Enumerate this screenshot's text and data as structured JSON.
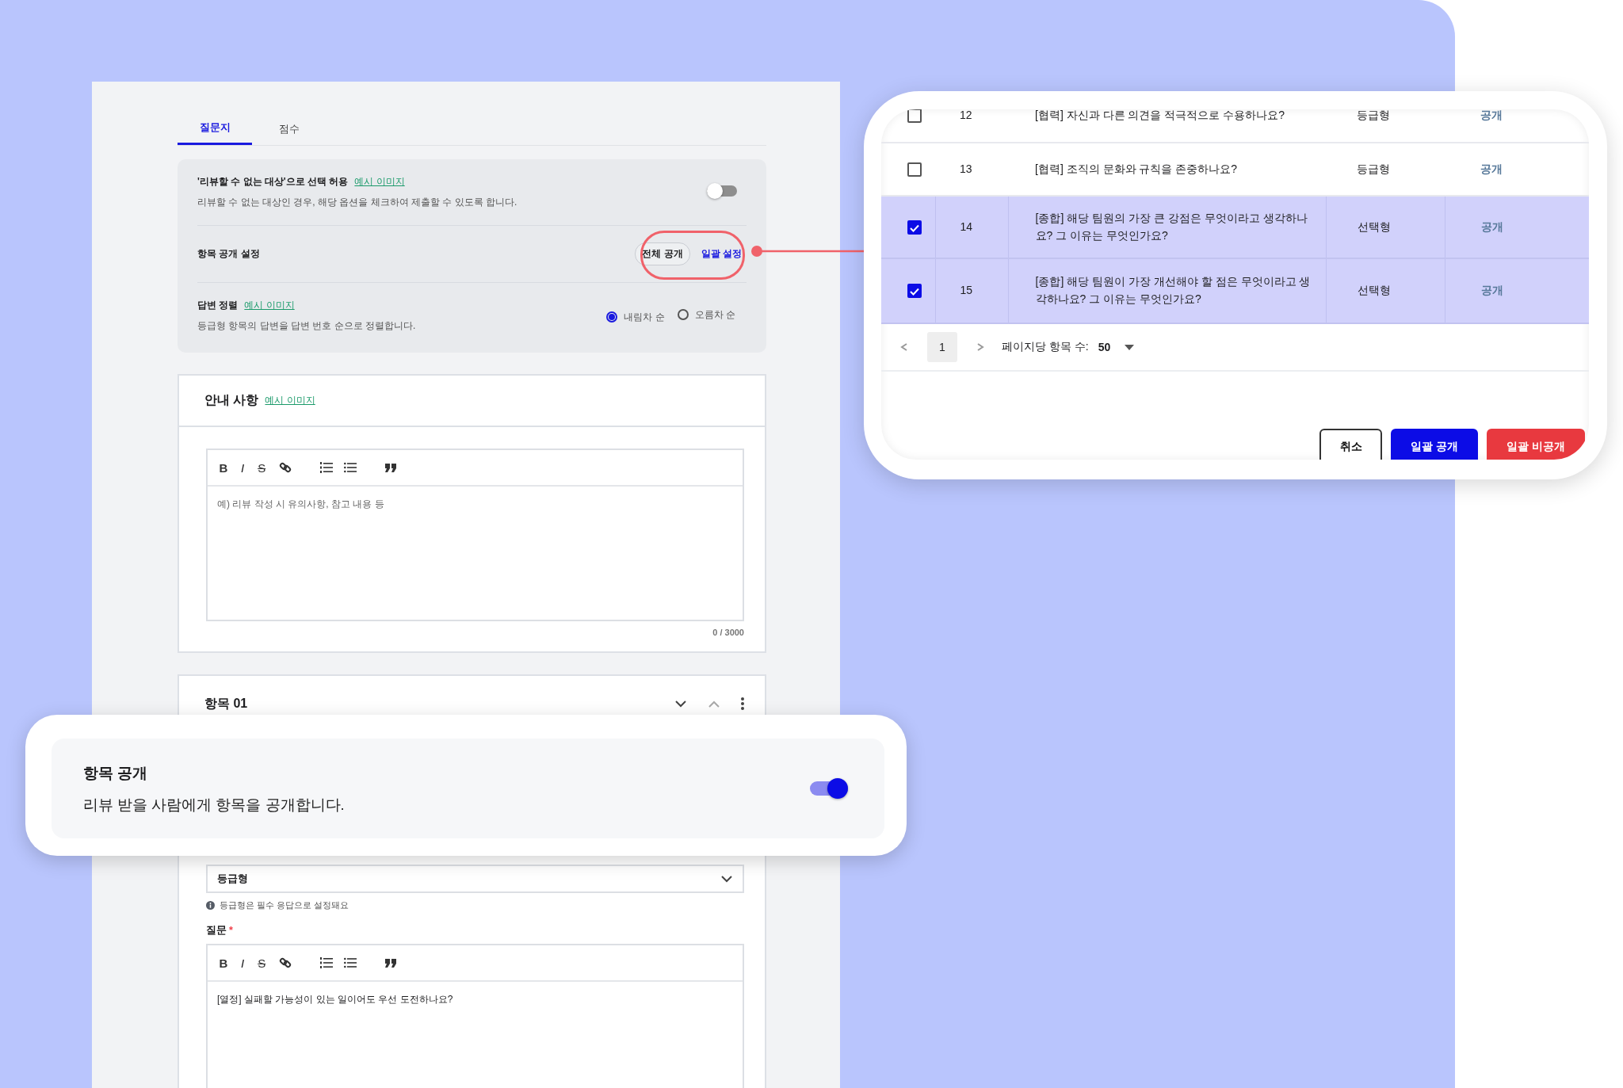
{
  "tabs": [
    {
      "label": "질문지",
      "selected": true
    },
    {
      "label": "점수",
      "selected": false
    }
  ],
  "settings": {
    "allow_unreviewable": {
      "title": "'리뷰할 수 없는 대상'으로 선택 허용",
      "link": "예시 이미지",
      "description": "리뷰할 수 없는 대상인 경우, 해당 옵션을 체크하여 제출할 수 있도록 합니다.",
      "on": false
    },
    "visibility": {
      "title": "항목 공개 설정",
      "pill": "전체 공개",
      "link": "일괄 설정"
    },
    "sort": {
      "title": "답변 정렬",
      "link": "예시 이미지",
      "description": "등급형 항목의 답변을 답변 번호 순으로 정렬합니다.",
      "options": [
        {
          "label": "내림차 순",
          "selected": true
        },
        {
          "label": "오름차 순",
          "selected": false
        }
      ]
    }
  },
  "notice": {
    "title": "안내 사항",
    "link": "예시 이미지",
    "toolbar": [
      {
        "kind": "bold",
        "label": "B"
      },
      {
        "kind": "italic",
        "label": "I"
      },
      {
        "kind": "strike",
        "label": "S"
      },
      {
        "kind": "link"
      },
      {
        "kind": "ordered-list"
      },
      {
        "kind": "bullet-list"
      },
      {
        "kind": "quote"
      }
    ],
    "placeholder": "예) 리뷰 작성 시 유의사항, 참고 내용 등",
    "counter": "0 / 3000"
  },
  "item": {
    "title": "항목 01",
    "type_value": "등급형",
    "hint": "등급형은 필수 응답으로 설정돼요",
    "question_label": "질문",
    "required_mark": "*",
    "toolbar": [
      {
        "kind": "bold",
        "label": "B"
      },
      {
        "kind": "italic",
        "label": "I"
      },
      {
        "kind": "strike",
        "label": "S"
      },
      {
        "kind": "link"
      },
      {
        "kind": "ordered-list"
      },
      {
        "kind": "bullet-list"
      },
      {
        "kind": "quote"
      }
    ],
    "question": "[열정] 실패할 가능성이 있는 일이어도 우선 도전하나요?"
  },
  "visibility_popup": {
    "title": "항목 공개",
    "description": "리뷰 받을 사람에게 항목을 공개합니다.",
    "on": true
  },
  "bulk_dialog": {
    "rows": [
      {
        "checked": false,
        "number": "12",
        "question": "[협력] 자신과 다른 의견을 적극적으로 수용하나요?",
        "type": "등급형",
        "status": "공개"
      },
      {
        "checked": false,
        "number": "13",
        "question": "[협력] 조직의 문화와 규칙을 존중하나요?",
        "type": "등급형",
        "status": "공개"
      },
      {
        "checked": true,
        "number": "14",
        "question": "[종합] 해당 팀원의 가장 큰 강점은 무엇이라고 생각하나요? 그 이유는 무엇인가요?",
        "type": "선택형",
        "status": "공개"
      },
      {
        "checked": true,
        "number": "15",
        "question": "[종합] 해당 팀원이 가장 개선해야 할 점은 무엇이라고 생각하나요? 그 이유는 무엇인가요?",
        "type": "선택형",
        "status": "공개"
      }
    ],
    "pagination": {
      "page": "1",
      "per_page_label": "페이지당 항목 수:",
      "per_page": "50"
    },
    "buttons": [
      {
        "label": "취소",
        "kind": "secondary"
      },
      {
        "label": "일괄 공개",
        "kind": "primary"
      },
      {
        "label": "일괄 비공개",
        "kind": "danger"
      }
    ]
  }
}
